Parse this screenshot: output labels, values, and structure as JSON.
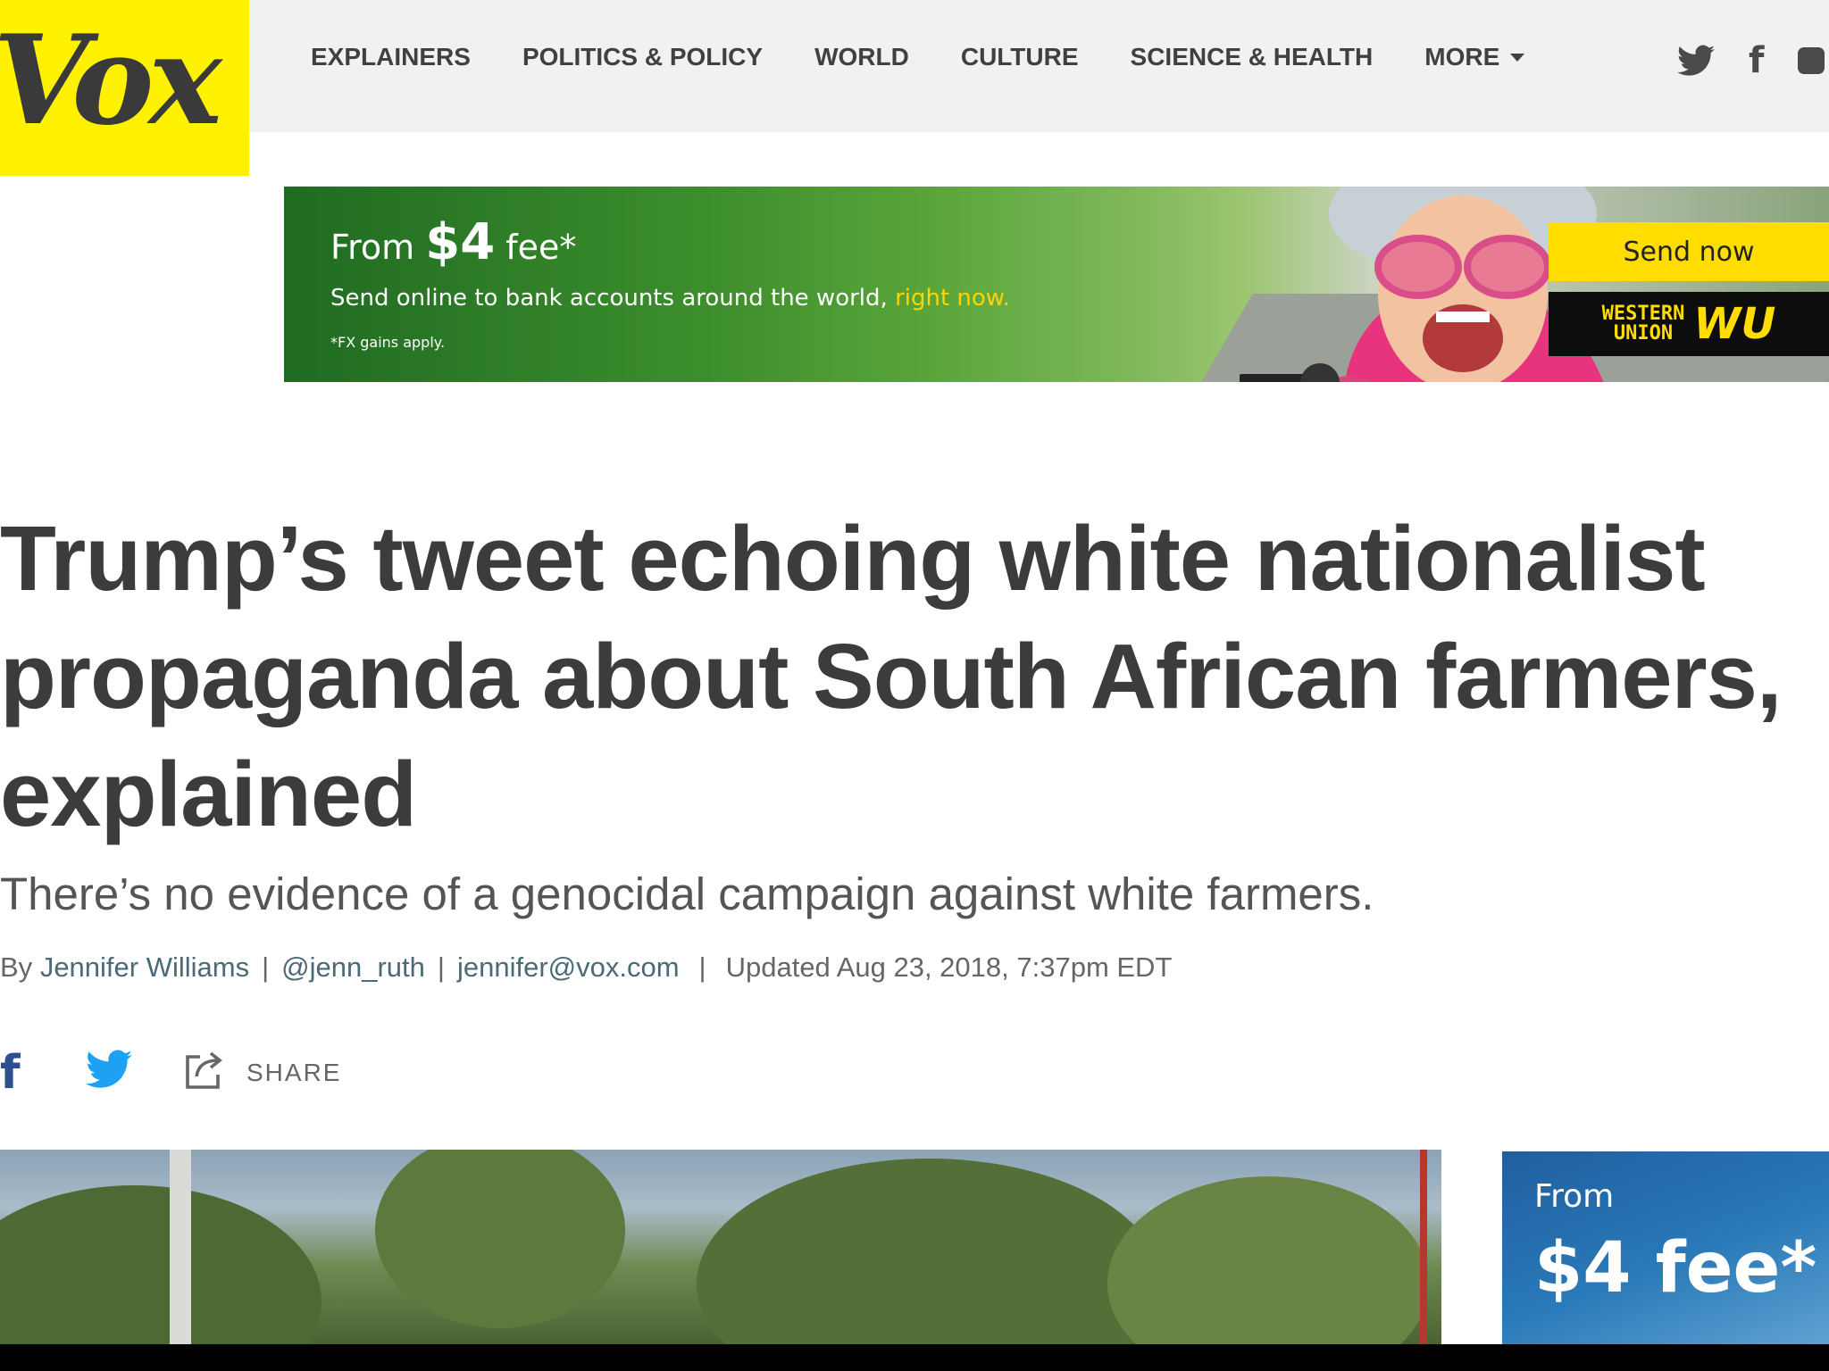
{
  "logo": {
    "text": "Vox"
  },
  "nav": {
    "items": [
      {
        "label": "EXPLAINERS"
      },
      {
        "label": "POLITICS & POLICY"
      },
      {
        "label": "WORLD"
      },
      {
        "label": "CULTURE"
      },
      {
        "label": "SCIENCE & HEALTH"
      },
      {
        "label": "MORE"
      }
    ],
    "social_icons": [
      "twitter-icon",
      "facebook-icon",
      "youtube-icon"
    ]
  },
  "ad_banner": {
    "from_label": "From",
    "price": "$4",
    "fee_label": "fee*",
    "tagline": "Send online to bank accounts around the world,",
    "tagline_highlight": "right now.",
    "fine_print": "*FX gains apply.",
    "cta": "Send now",
    "brand_line1": "WESTERN",
    "brand_line2": "UNION",
    "brand_mark": "WU"
  },
  "article": {
    "headline": "Trump’s tweet echoing white nationalist propaganda about South African farmers, explained",
    "dek": "There’s no evidence of a genocidal campaign against white farmers.",
    "byline": {
      "by_label": "By",
      "author": "Jennifer Williams",
      "handle": "@jenn_ruth",
      "email": "jennifer@vox.com",
      "updated": "Updated Aug 23, 2018, 7:37pm EDT"
    },
    "share": {
      "facebook_glyph": "f",
      "share_label": "SHARE"
    }
  },
  "side_ad": {
    "from_label": "From",
    "price_fee": "$4 fee*"
  },
  "colors": {
    "logo_yellow": "#fff200",
    "header_bg": "#f0f1f1",
    "headline": "#3c3c3c",
    "link": "#4b6a75",
    "twitter_blue": "#1da1f2",
    "facebook_blue": "#2b4f8f",
    "wu_yellow": "#ffdd00"
  }
}
